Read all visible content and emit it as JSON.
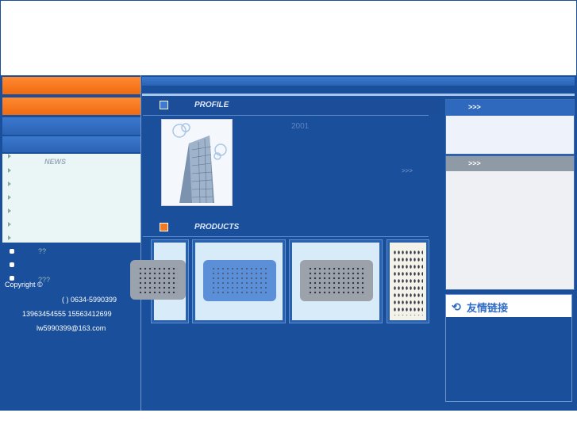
{
  "left": {
    "nav_items": [
      "NEWS",
      "",
      "",
      "",
      "",
      ""
    ],
    "contact_items": [
      "??",
      "",
      "???"
    ],
    "copyright": "Copyright ©",
    "phone": "( ) 0634-5990399",
    "mobile": "13963454555 15563412699",
    "email": "lw5990399@163.com"
  },
  "center": {
    "profile_title": "PROFILE",
    "profile_year": "2001",
    "more_link": ">>>",
    "products_title": "PRODUCTS"
  },
  "right": {
    "panel1_more": ">>>",
    "panel2_more": ">>>",
    "links_title": "友情链接"
  },
  "colors": {
    "main_blue": "#1a4f9c",
    "orange": "#f47a20"
  }
}
